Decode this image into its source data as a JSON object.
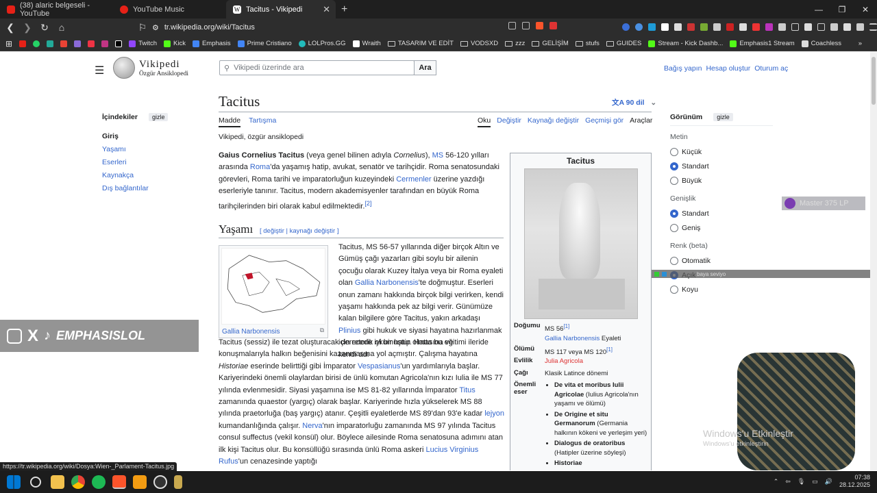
{
  "browser": {
    "tabs": [
      {
        "title": "(38) alaric belgeseli - YouTube",
        "color": "#e62117"
      },
      {
        "title": "YouTube Music",
        "color": "#e62117"
      },
      {
        "title": "Tacitus - Vikipedi",
        "color": "#ffffff"
      }
    ],
    "url": "tr.wikipedia.org/wiki/Tacitus",
    "bookmarks": [
      "Twitch",
      "Kick",
      "Emphasis",
      "Prime Cristiano",
      "LOLPros.GG",
      "Wraith",
      "TASARIM VE EDİT",
      "VODSXD",
      "zzz",
      "GELİŞİM",
      "stufs",
      "GUIDES",
      "Stream - Kick Dashb...",
      "Emphasis1 Stream",
      "Coachless"
    ],
    "status_url": "https://tr.wikipedia.org/wiki/Dosya:Wien-_Parlament-Tacitus.jpg"
  },
  "wiki": {
    "wordmark_top": "Vikipedi",
    "wordmark_bottom": "Özgür Ansiklopedi",
    "search_placeholder": "Vikipedi üzerinde ara",
    "search_button": "Ara",
    "user_links": [
      "Bağış yapın",
      "Hesap oluştur",
      "Oturum aç"
    ],
    "toc": {
      "title": "İçindekiler",
      "hide": "gizle",
      "items": [
        "Giriş",
        "Yaşamı",
        "Eserleri",
        "Kaynakça",
        "Dış bağlantılar"
      ]
    },
    "page_title": "Tacitus",
    "languages": "90 dil",
    "tabs_left": [
      "Madde",
      "Tartışma"
    ],
    "tabs_right": [
      "Oku",
      "Değiştir",
      "Kaynağı değiştir",
      "Geçmişi gör",
      "Araçlar"
    ],
    "tagline": "Vikipedi, özgür ansiklopedi",
    "section_title": "Yaşamı",
    "section_edit": "[ değiştir | kaynağı değiştir ]",
    "thumb_caption": "Gallia Narbonensis",
    "infobox": {
      "title": "Tacitus",
      "born_label": "Doğumu",
      "born_value": "MS 56",
      "born_place": "Gallia Narbonensis",
      "born_place_suffix": " Eyaleti",
      "died_label": "Ölümü",
      "died_value": "MS 117 veya MS 120",
      "spouse_label": "Evlilik",
      "spouse_value": "Julia Agricola",
      "era_label": "Çağı",
      "era_value": "Klasik Latince dönemi",
      "works_label": "Önemli eser",
      "works": [
        {
          "bold": "De vita et moribus Iulii Agricolae",
          "note": " (Iulius Agricola'nın yaşamı ve ölümü)"
        },
        {
          "bold": "De Origine et situ Germanorum",
          "note": " (Germania halkının kökeni ve yerleşim yeri)"
        },
        {
          "bold": "Dialogus de oratoribus",
          "note": " (Hatipler üzerine söyleşi)"
        },
        {
          "bold": "Historiae",
          "note": ""
        }
      ]
    },
    "appearance": {
      "title": "Görünüm",
      "hide": "gizle",
      "text_group": "Metin",
      "text_options": [
        "Küçük",
        "Standart",
        "Büyük"
      ],
      "width_group": "Genişlik",
      "width_options": [
        "Standart",
        "Geniş"
      ],
      "color_group": "Renk (beta)",
      "color_options": [
        "Otomatik",
        "Açık",
        "Koyu"
      ]
    }
  },
  "overlays": {
    "social_tag": "EMPHASISLOL",
    "rank_badge": "Master  375 LP",
    "chat_line": "baya seviyo",
    "windows_title": "Windows'u Etkinleştir",
    "windows_sub": "Windows'u etkinleştirin"
  },
  "taskbar": {
    "time": "07:38",
    "date": "28.12.2025"
  },
  "colors": {
    "link": "#3366cc",
    "redlink": "#dd3333",
    "chrome_dark": "#1f1f1f"
  }
}
